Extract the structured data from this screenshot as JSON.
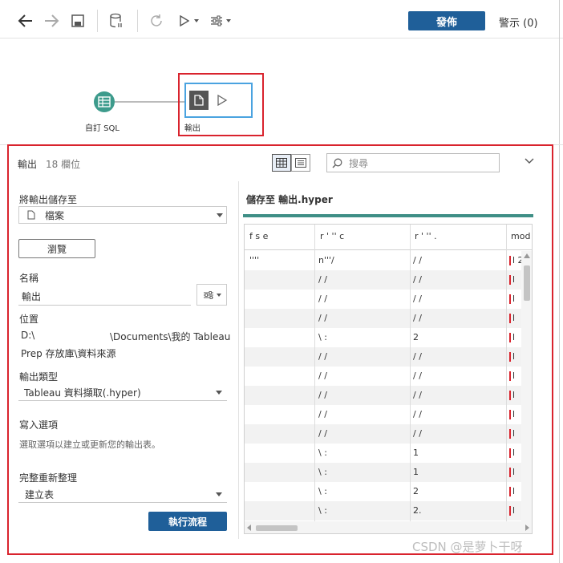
{
  "toolbar": {
    "publish_label": "發佈",
    "alerts_label": "警示 (0)"
  },
  "flow": {
    "input_node_label": "自訂 SQL",
    "output_node_label": "輸出"
  },
  "panel": {
    "title": "輸出",
    "field_count": "18 欄位",
    "search_placeholder": "搜尋"
  },
  "form": {
    "save_to_label": "將輸出儲存至",
    "save_to_value": "檔案",
    "browse_label": "瀏覽",
    "name_label": "名稱",
    "name_value": "輸出",
    "location_label": "位置",
    "location_prefix": "D:\\",
    "location_suffix": "\\Documents\\我的 Tableau",
    "location_line2": "Prep 存放庫\\資料來源",
    "output_type_label": "輸出類型",
    "output_type_value": "Tableau 資料擷取(.hyper)",
    "write_options_label": "寫入選項",
    "write_options_hint": "選取選項以建立或更新您的輸出表。",
    "full_refresh_label": "完整重新整理",
    "full_refresh_value": "建立表",
    "run_flow_label": "執行流程"
  },
  "preview": {
    "title": "儲存至 輸出.hyper",
    "headers": [
      "f    s          e",
      "r    '       ''     c",
      "r    '       ''      .",
      "mod"
    ],
    "rows": [
      [
        "''''",
        "n'''/",
        "/    /",
        "l 2"
      ],
      [
        "",
        "/    /",
        "/    /",
        "l"
      ],
      [
        "",
        "/    /",
        "/    /",
        "l"
      ],
      [
        "",
        "/    /",
        "/    /",
        "l"
      ],
      [
        "",
        "\\    :",
        "2",
        "l"
      ],
      [
        "",
        "/    /",
        "/    /",
        "l"
      ],
      [
        "",
        "/    /",
        "/    /",
        "l"
      ],
      [
        "",
        "/    /",
        "/    /",
        "l"
      ],
      [
        "",
        "/    /",
        "/    /",
        "l"
      ],
      [
        "",
        "/    /",
        "/    /",
        "l"
      ],
      [
        "",
        "\\    :",
        "1",
        "l"
      ],
      [
        "",
        "\\    :",
        "1",
        "l"
      ],
      [
        "",
        "\\    :",
        "2",
        "l"
      ],
      [
        "",
        "\\    :",
        "2.",
        "l"
      ]
    ]
  },
  "watermark": "CSDN @是萝卜干呀",
  "colors": {
    "brand_blue": "#1f5f99",
    "highlight_red": "#d9232d",
    "teal": "#3f8f86",
    "selected_border": "#4aa3e0"
  }
}
